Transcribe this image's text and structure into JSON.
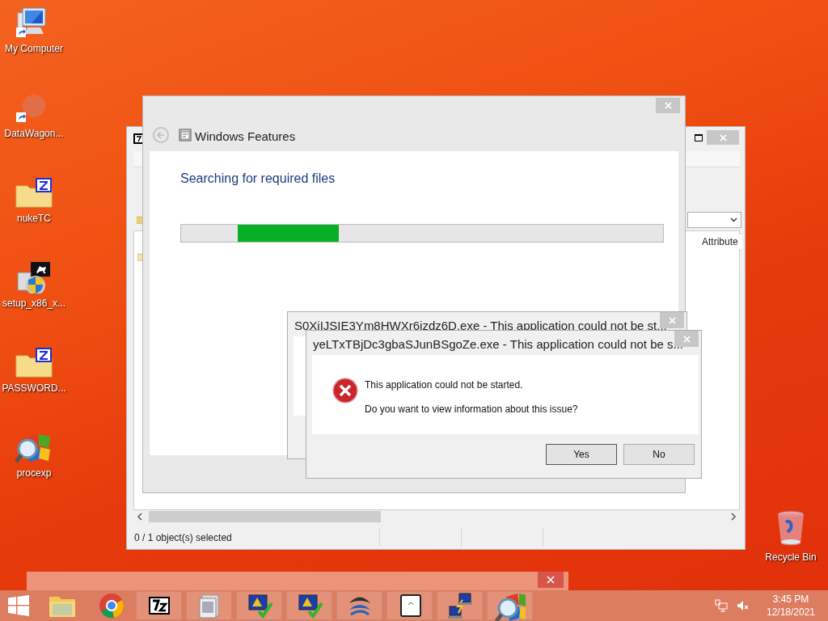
{
  "desktop_icons": [
    {
      "label": "My Computer",
      "kind": "computer",
      "shortcut": true
    },
    {
      "label": "DataWagon...",
      "kind": "blank",
      "shortcut": true
    },
    {
      "label": "nukeTC",
      "kind": "zipfolder",
      "shortcut": false
    },
    {
      "label": "setup_x86_x...",
      "kind": "installer",
      "shortcut": false
    },
    {
      "label": "PASSWORD...",
      "kind": "zipfolder",
      "shortcut": false
    },
    {
      "label": "procexp",
      "kind": "procexp",
      "shortcut": false
    }
  ],
  "recycle_bin": {
    "label": "Recycle Bin"
  },
  "archive_window": {
    "attributes_column": "Attribute",
    "status_text": "0 / 1 object(s) selected"
  },
  "features_window": {
    "title": "Windows Features",
    "heading": "Searching for required files",
    "progress": {
      "level": 0.21
    }
  },
  "error_dialogs": [
    {
      "title": "S0XiIJSIE3Ym8HWXr6jzdz6D.exe - This application could not be st..."
    },
    {
      "title": "yeLTxTBjDc3gbaSJunBSgoZe.exe - This application could not be s...",
      "message": "This application could not be started.",
      "question": "Do you want to view information about this issue?",
      "buttons": [
        "Yes",
        "No"
      ]
    }
  ],
  "taskbar": {
    "apps": [
      {
        "kind": "explorer",
        "open": false
      },
      {
        "kind": "chrome",
        "open": false
      },
      {
        "kind": "sevenzip",
        "open": true
      },
      {
        "kind": "gallery",
        "open": true
      },
      {
        "kind": "monitor",
        "open": true
      },
      {
        "kind": "monitor",
        "open": true
      },
      {
        "kind": "wave",
        "open": true
      },
      {
        "kind": "whitebox",
        "open": true
      },
      {
        "kind": "network",
        "open": true
      },
      {
        "kind": "procexp",
        "open": true
      }
    ],
    "clock": {
      "time": "3:45 PM",
      "date": "12/18/2021"
    }
  }
}
